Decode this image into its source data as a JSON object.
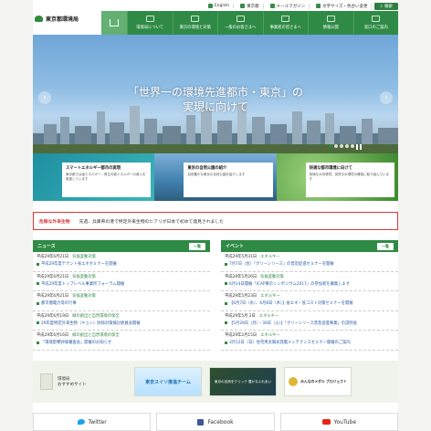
{
  "util": {
    "english": "English",
    "tokyo": "東京都",
    "magazine": "メールマガジン",
    "font": "文字サイズ・色合い変更",
    "search": "検索"
  },
  "header": {
    "logo": "東京都環境局",
    "nav": [
      {
        "label": "環境局について"
      },
      {
        "label": "東京の環境と対策"
      },
      {
        "label": "一般のお客さまへ"
      },
      {
        "label": "事業者の皆さまへ"
      },
      {
        "label": "情報公開"
      },
      {
        "label": "窓口のご案内"
      }
    ]
  },
  "hero": {
    "line1": "「世界一の環境先進都市・東京」の",
    "line2": "実現に向けて",
    "prev": "‹",
    "next": "›"
  },
  "cards": [
    {
      "title": "スマートエネルギー都市の実現",
      "desc": "東京都では省エネルギー・再生可能エネルギーの導入を推進しています"
    },
    {
      "title": "東京の自然公園の紹介",
      "desc": "自然豊かな東京の自然公園を紹介します"
    },
    {
      "title": "快適な都市環境に向けて",
      "desc": "快適な大気環境、良質な水環境の確保に取り組んでいます"
    }
  ],
  "notice": {
    "label": "危険な外来生物",
    "text": "先週、兵庫県の港で特定外来生物のヒアリが日本で初めて発見されました"
  },
  "news": {
    "title": "ニュース",
    "more": "一覧",
    "items": [
      {
        "date": "平成29年6月21日",
        "cat": "気候変動対策",
        "title": "平成29年度テナント省エネセミナーを開催"
      },
      {
        "date": "平成29年6月21日",
        "cat": "気候変動対策",
        "title": "平成29年度トップレベル事業所フォーラム開催"
      },
      {
        "date": "平成29年6月21日",
        "cat": "気候変動対策",
        "title": "都市圏電力等の行事"
      },
      {
        "date": "平成29年6月19日",
        "cat": "緑の創出と自然環境の保全",
        "title": "29年度特定外来生物（キョン）防除対策検討委員会開催"
      },
      {
        "date": "平成29年6月16日",
        "cat": "緑の創出と自然環境の保全",
        "title": "「環境影響評価審査会」開催のお知らせ"
      }
    ]
  },
  "event": {
    "title": "イベント",
    "more": "一覧",
    "items": [
      {
        "date": "平成29年5月31日",
        "cat": "エネルギー",
        "title": "7月7日（金）「グリーンリース」の普及促進セミナーを開催"
      },
      {
        "date": "平成29年5月26日",
        "cat": "気候変動対策",
        "title": "6月14日開催「ICAP東京シンポジウム2017」の参加者を募集します"
      },
      {
        "date": "平成29年5月23日",
        "cat": "エネルギー",
        "title": "【6月7日（水）、6月8日（木）】省エネ・低コスト対策セミナーを開催"
      },
      {
        "date": "平成29年5月 2日",
        "cat": "エネルギー",
        "title": "【5月29日（月）・30日（火）】「グリーンリース普及促進事業」の説明会"
      },
      {
        "date": "平成29年2月15日",
        "cat": "エネルギー",
        "title": "3月12日（日）住宅用太陽光発電メンテナンスセミナー開催のご案内"
      }
    ]
  },
  "recommended": {
    "label1": "環境局",
    "label2": "おすすめサイト",
    "banners": [
      {
        "text": "東京スイソ推進チーム"
      },
      {
        "text": "東京の自然をクリック 豊かなふれあい"
      },
      {
        "text": "みんなのメダル プロジェクト"
      }
    ]
  },
  "social": [
    {
      "label": "Twitter"
    },
    {
      "label": "Facebook"
    },
    {
      "label": "YouTube"
    }
  ]
}
